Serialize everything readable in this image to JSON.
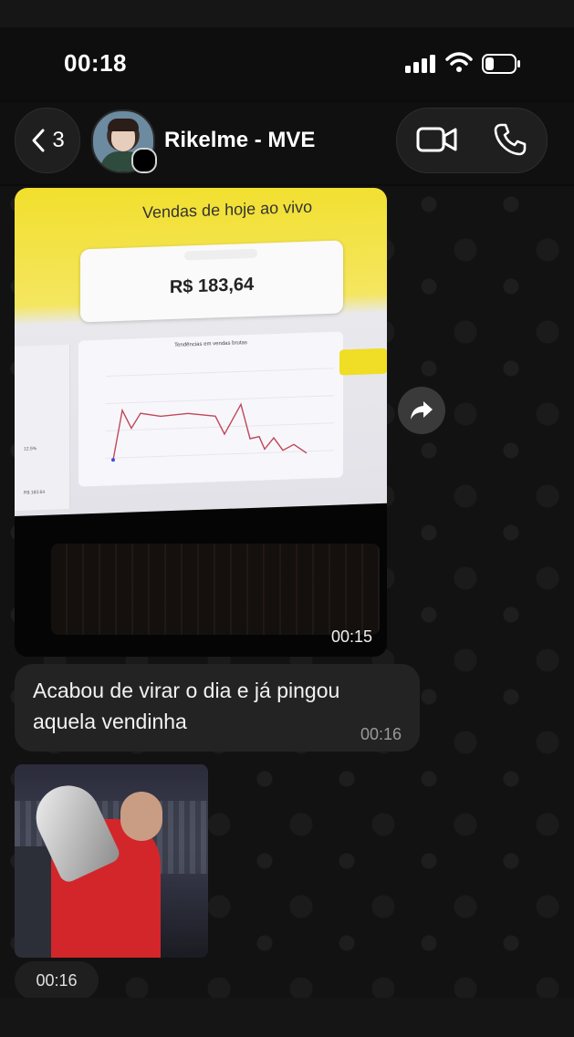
{
  "status_bar": {
    "time": "00:18"
  },
  "header": {
    "back_count": "3",
    "contact_name": "Rikelme - MVE"
  },
  "messages": {
    "media1": {
      "screen_title": "Vendas de hoje ao vivo",
      "total_value": "R$ 183,64",
      "chart_title": "Tendências em vendas brutas",
      "panel_value_1": "12.5%",
      "panel_value_2": "R$ 183.64",
      "time": "00:15"
    },
    "text": {
      "body": "Acabou de virar o dia e já pingou aquela vendinha",
      "time": "00:16"
    },
    "media2": {
      "time": "00:16"
    }
  },
  "colors": {
    "background": "#0b0b0b",
    "bubble": "#232323",
    "screen_accent": "#f2df2c"
  },
  "icons": [
    "back-chevron-icon",
    "video-call-icon",
    "phone-call-icon",
    "forward-icon",
    "signal-icon",
    "wifi-icon",
    "battery-icon"
  ]
}
